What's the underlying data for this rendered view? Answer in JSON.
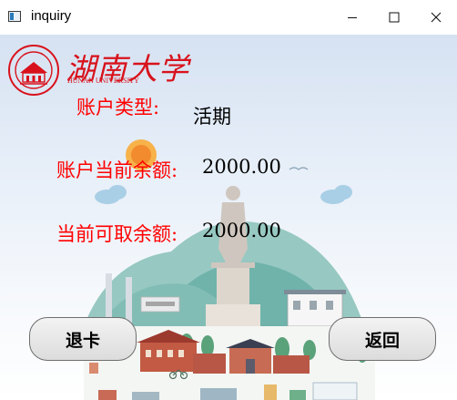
{
  "window": {
    "title": "inquiry",
    "app_icon": "window-app-icon",
    "controls": [
      "minimize-icon",
      "maximize-icon",
      "close-icon"
    ]
  },
  "logo": {
    "name_cn": "湖南大学",
    "name_en": "HUNAN UNIVERSITY",
    "color": "#d8121c"
  },
  "account": {
    "type_label": "账户类型:",
    "type_value": "活期",
    "balance_label": "账户当前余额:",
    "balance_value": "2000.00",
    "available_label": "当前可取余额:",
    "available_value": "2000.00"
  },
  "buttons": {
    "exit_card": "退卡",
    "back": "返回"
  },
  "colors": {
    "label": "#ff0000",
    "value": "#000000"
  }
}
